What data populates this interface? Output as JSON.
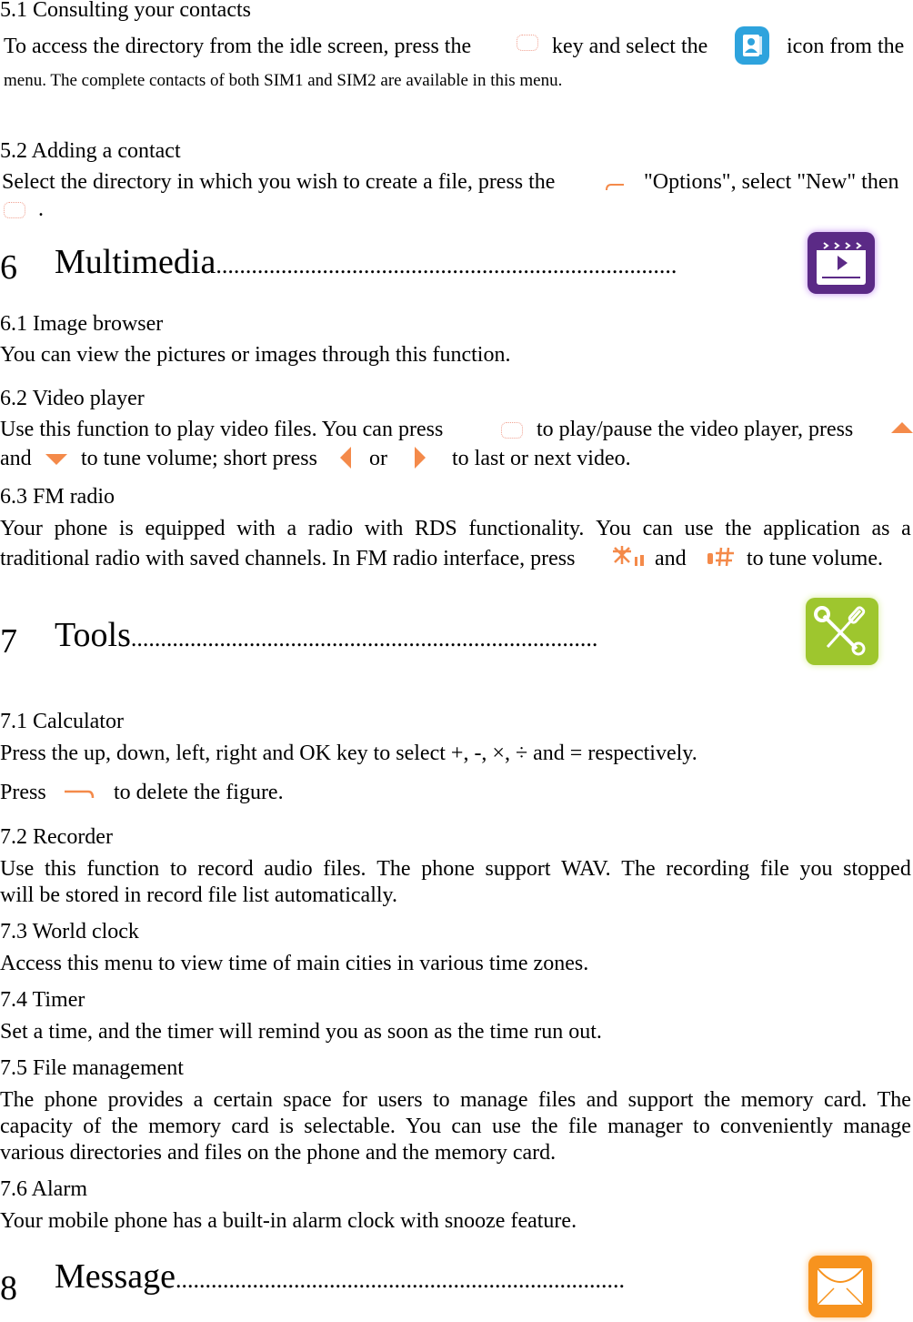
{
  "sections": {
    "s5_1": {
      "title": "5.1  Consulting your contacts",
      "line1_a": "To access the directory from the idle screen, press the",
      "line1_b": "key and select the",
      "line1_c": "icon from the",
      "line2": "menu. The complete contacts of both SIM1 and SIM2 are available in this menu."
    },
    "s5_2": {
      "title": "5.2  Adding a contact",
      "line1_a": "Select the directory in which you wish to create a file, press the",
      "line1_b": "\"Options\", select \"New\" then",
      "line2": "."
    },
    "ch6": {
      "number": "6",
      "title": "Multimedia",
      "leader": "..............................................................................",
      "icon": "video-clapper-icon",
      "icon_color": "#5b2a86"
    },
    "s6_1": {
      "title": "6.1  Image browser",
      "body": "You can view the pictures or images through this function."
    },
    "s6_2": {
      "title": "6.2    Video player",
      "line1_a": "Use this function to play video files. You can press",
      "line1_b": "to play/pause the video player, press",
      "line2_a": "and",
      "line2_b": "to tune volume; short press",
      "line2_c": "or",
      "line2_d": "to last or next video."
    },
    "s6_3": {
      "title": "6.3  FM radio",
      "line1": "Your phone is equipped with a radio with RDS functionality. You can use the application as a",
      "line2_a": "traditional radio with saved channels. In FM radio interface, press",
      "line2_b": "and",
      "line2_c": "to tune volume."
    },
    "ch7": {
      "number": "7",
      "title": "Tools",
      "leader": "...............................................................................",
      "icon": "tools-icon",
      "icon_color": "#9ec62e"
    },
    "s7_1": {
      "title": "7.1  Calculator",
      "line1": "Press the up, down, left, right and OK key to select +, -, ×, ÷ and = respectively.",
      "line2_a": "Press",
      "line2_b": "to delete the figure."
    },
    "s7_2": {
      "title": "7.2  Recorder",
      "line1": "Use this function to record audio files. The phone support WAV. The recording file you stopped",
      "line2": "will be stored in record file list automatically."
    },
    "s7_3": {
      "title": "7.3  World clock",
      "body": "Access this menu to view time of main cities in various time zones."
    },
    "s7_4": {
      "title": "7.4  Timer",
      "body": "Set a time, and the timer will remind you as soon as the time run out."
    },
    "s7_5": {
      "title": "7.5  File management",
      "line1": "The phone provides a certain space for users to manage files and support the memory card. The",
      "line2": "capacity of the memory card is selectable. You can use the file manager to conveniently manage",
      "line3": "various directories and files on the phone and the memory card."
    },
    "s7_6": {
      "title": "7.6  Alarm",
      "body": "Your mobile phone has a built-in alarm clock with snooze feature."
    },
    "ch8": {
      "number": "8",
      "title": "Message",
      "leader": "............................................................................",
      "icon": "envelope-icon",
      "icon_color": "#f7931e"
    }
  },
  "colors": {
    "key_orange": "#f48a4a",
    "contacts_blue": "#2ea3dd"
  }
}
